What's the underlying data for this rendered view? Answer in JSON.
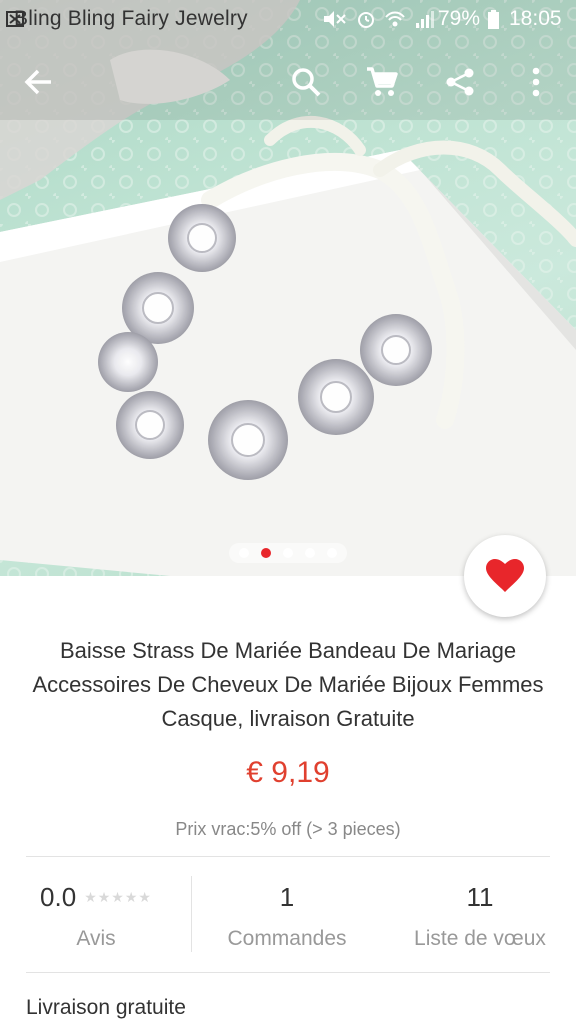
{
  "status_bar": {
    "app_name": "Bling Bling Fairy Jewelry",
    "battery": "79%",
    "time": "18:05"
  },
  "toolbar": {
    "back_icon": "arrow-left-icon",
    "search_icon": "search-icon",
    "cart_icon": "shopping-cart-icon",
    "share_icon": "share-icon",
    "more_icon": "more-vert-icon"
  },
  "carousel": {
    "total": 5,
    "active_index": 1
  },
  "favorite": {
    "icon": "heart-icon",
    "color": "#e8262b"
  },
  "product": {
    "title": "Baisse Strass De Mariée Bandeau De Mariage Accessoires De Cheveux De Mariée Bijoux Femmes Casque, livraison Gratuite",
    "price": "€ 9,19",
    "bulk_price": "Prix vrac:5% off (> 3 pieces)"
  },
  "stats": {
    "rating_value": "0.0",
    "rating_label": "Avis",
    "rating_stars": "★★★★★",
    "orders_value": "1",
    "orders_label": "Commandes",
    "wishlist_value": "11",
    "wishlist_label": "Liste de vœux"
  },
  "shipping": {
    "label": "Livraison gratuite"
  },
  "colors": {
    "accent": "#e8262b",
    "price": "#e0402f"
  }
}
